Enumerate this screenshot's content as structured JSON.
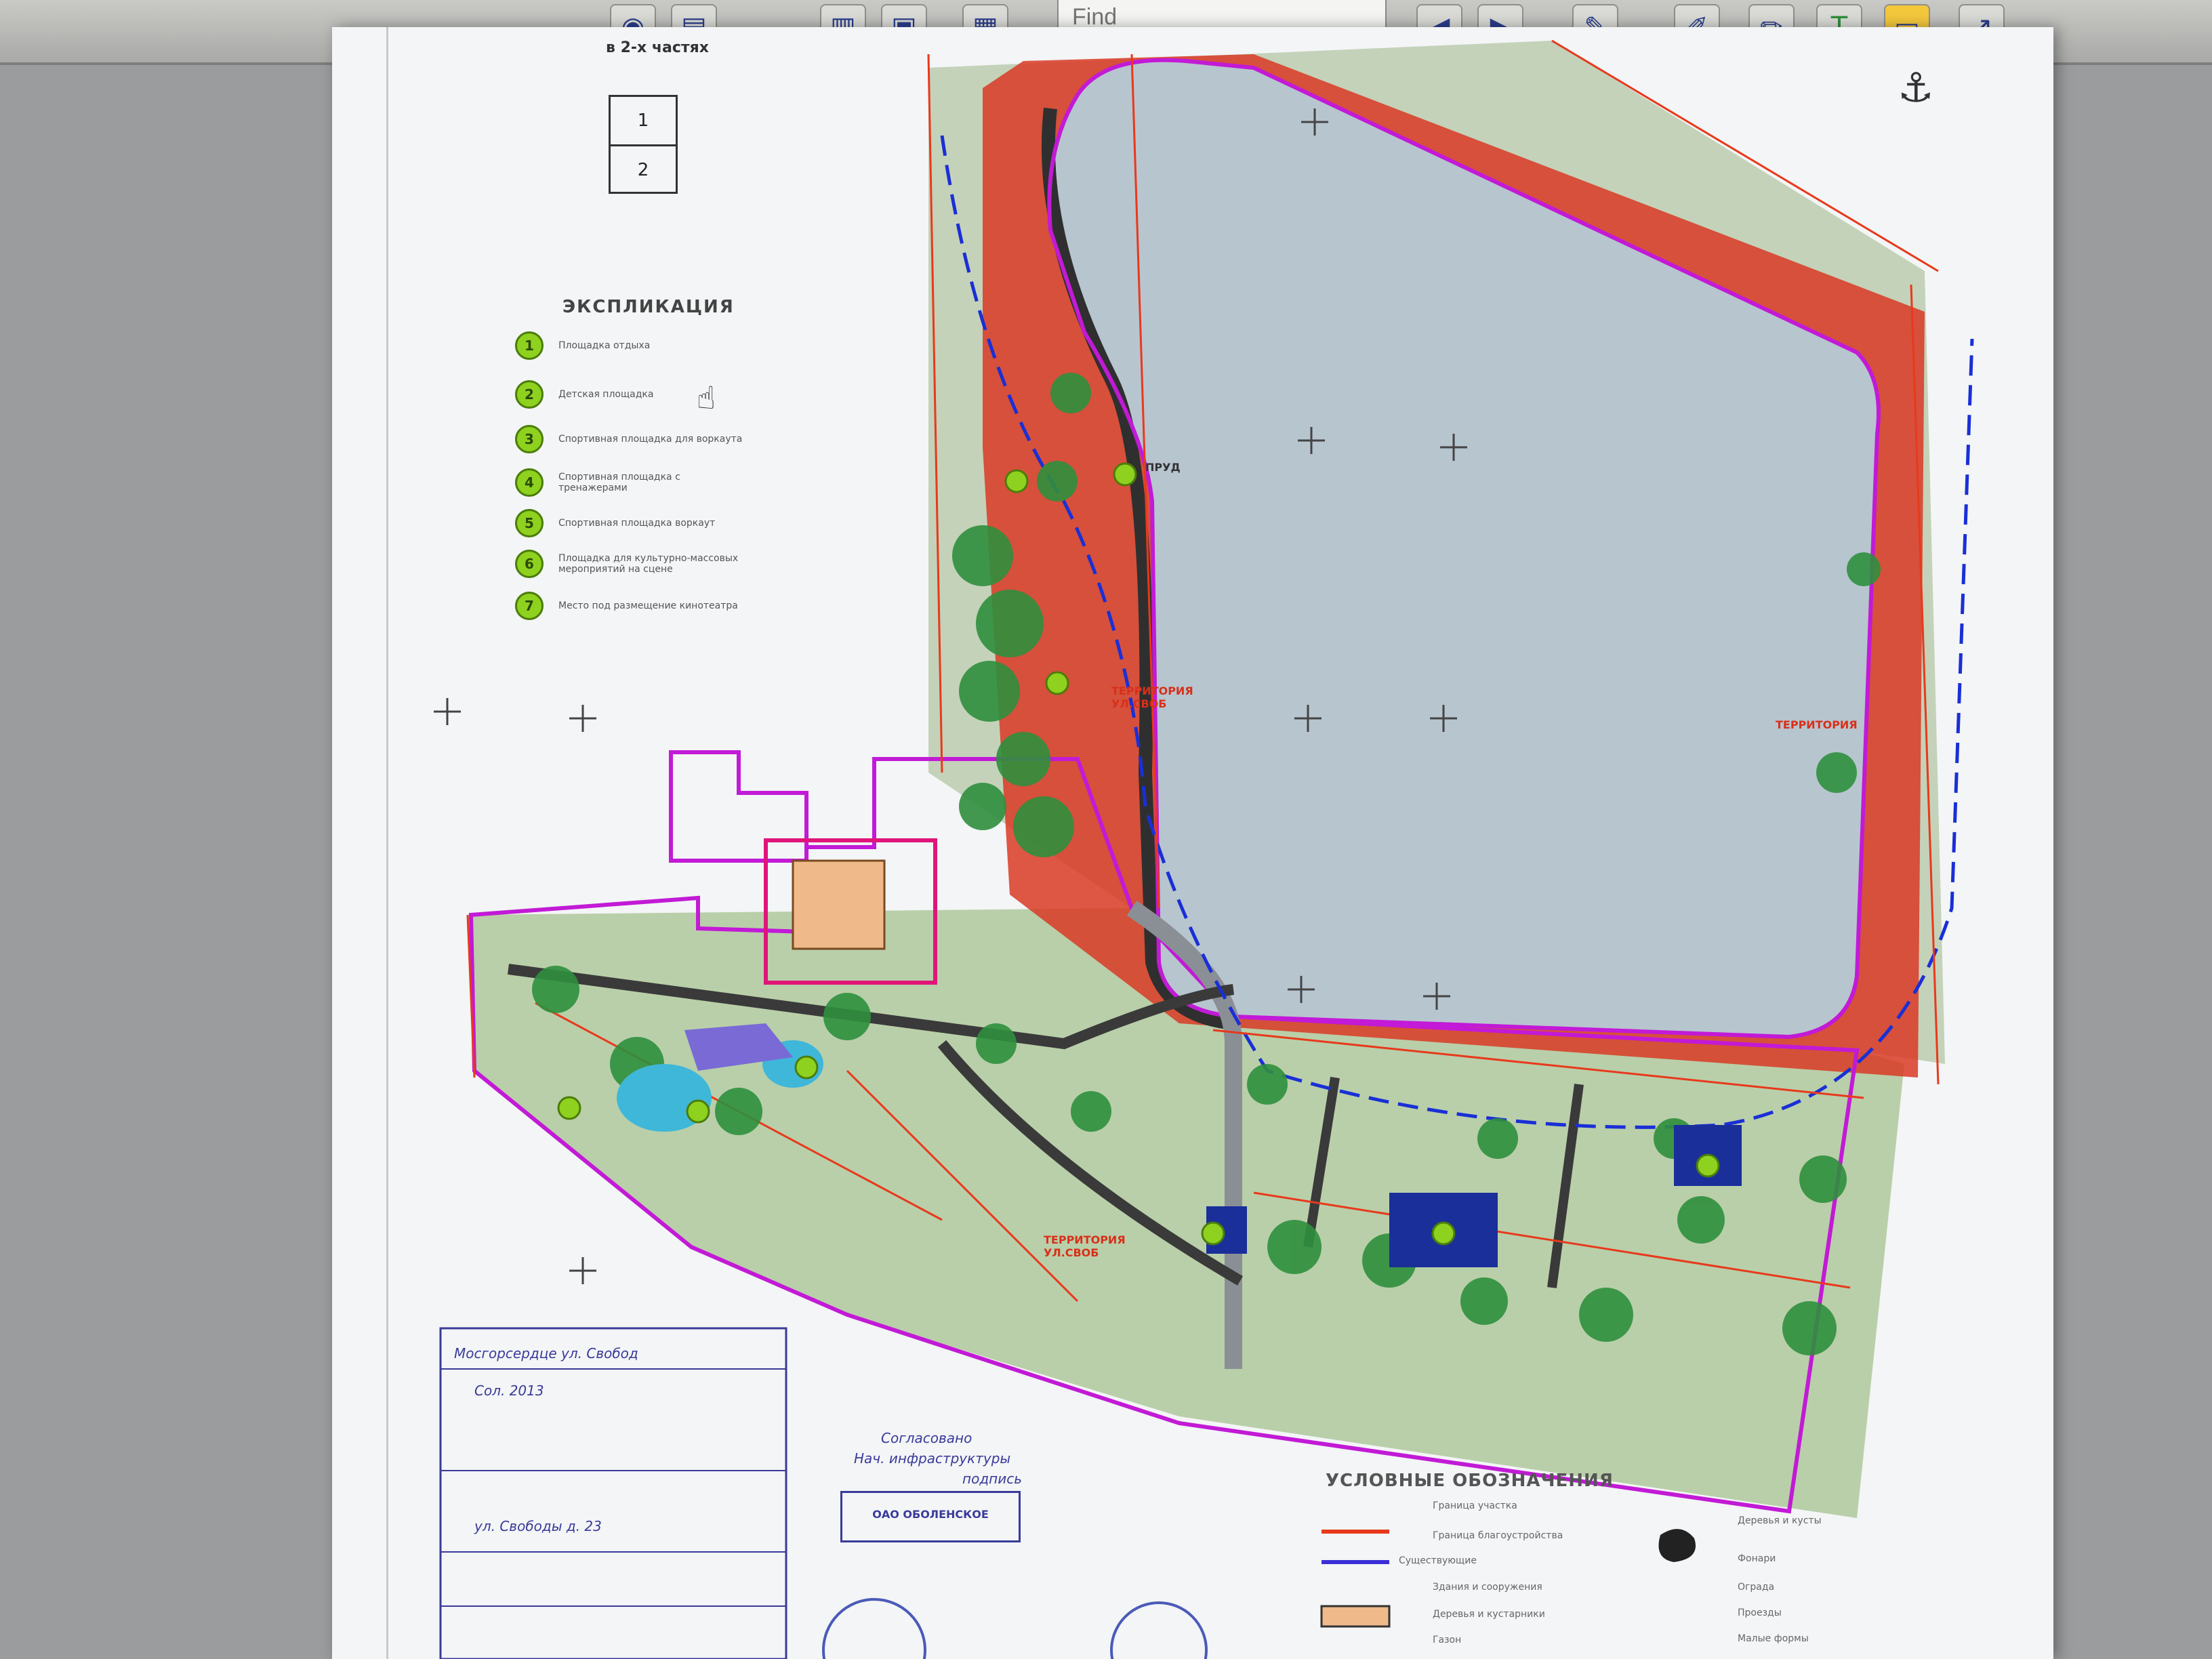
{
  "toolbar": {
    "find_placeholder": "Find",
    "tools": [
      {
        "name": "pencil-icon",
        "glyph": "✎"
      },
      {
        "name": "stamp-icon",
        "glyph": "✐"
      },
      {
        "name": "highlighter-icon",
        "glyph": "✏"
      },
      {
        "name": "text-box-icon",
        "glyph": "T"
      },
      {
        "name": "comment-icon",
        "glyph": "▭"
      },
      {
        "name": "arrow-icon",
        "glyph": "↗"
      }
    ]
  },
  "drawing": {
    "header": "в 2-х частях",
    "sheet_index": [
      "1",
      "2"
    ],
    "explication_title": "ЭКСПЛИКАЦИЯ",
    "explication_items": [
      {
        "num": "1",
        "text": "Площадка отдыха"
      },
      {
        "num": "2",
        "text": "Детская площадка"
      },
      {
        "num": "3",
        "text": "Спортивная площадка для воркаута"
      },
      {
        "num": "4",
        "text": "Спортивная площадка с тренажерами"
      },
      {
        "num": "5",
        "text": "Спортивная площадка воркаут"
      },
      {
        "num": "6",
        "text": "Площадка для культурно-массовых мероприятий на сцене"
      },
      {
        "num": "7",
        "text": "Место под размещение кинотеатра"
      }
    ],
    "map_labels": {
      "pond": "ПРУД",
      "territory_1": "ТЕРРИТОРИЯ УЛ.СВОБ",
      "territory_2": "ТЕРРИТОРИЯ УЛ.СВОБ",
      "territory_3": "ТЕРРИТОРИЯ"
    },
    "legend_title": "УСЛОВНЫЕ ОБОЗНАЧЕНИЯ",
    "legend_items": [
      "Граница участка",
      "Граница благоустройства",
      "Существующие",
      "Здания и сооружения",
      "Деревья и кустарники",
      "Газон"
    ],
    "legend_items_right": [
      "Деревья и кусты",
      "Фонари",
      "Ограда",
      "Проезды",
      "Малые формы"
    ],
    "stamp": {
      "title": "ОАО ОБОЛЕНСКОЕ",
      "lines": [
        "Мосгорсердце ул. Свобод",
        "Сол. 2013",
        "ул. Свободы д. 23"
      ]
    },
    "signature_block": [
      "Согласовано",
      "Нач. инфраструктуры",
      "подпись"
    ]
  },
  "colors": {
    "boundary_red": "#e8391c",
    "boundary_magenta": "#c21ad6",
    "water": "#b7c5cf",
    "lawn": "#b9cfa9",
    "tree": "#2f8f3d",
    "path": "#3a3a3a",
    "route_blue": "#1a2fd6",
    "badge_green": "#8ed11f",
    "building": "#f0b98a",
    "stamp_blue": "#3a3a9a"
  }
}
